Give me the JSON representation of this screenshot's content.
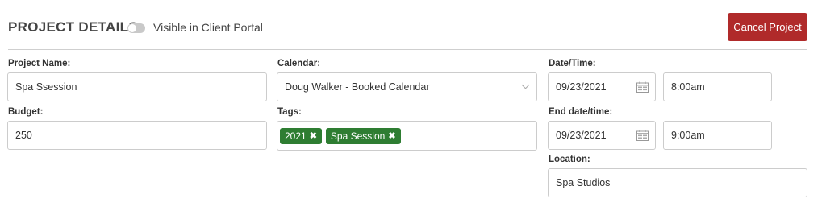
{
  "header": {
    "title": "PROJECT DETAILS:",
    "toggle_label": "Visible in Client Portal",
    "cancel_label": "Cancel Project"
  },
  "fields": {
    "project_name": {
      "label": "Project Name:",
      "value": "Spa Ssession"
    },
    "budget": {
      "label": "Budget:",
      "value": "250"
    },
    "calendar": {
      "label": "Calendar:",
      "value": "Doug Walker - Booked Calendar"
    },
    "tags": {
      "label": "Tags:",
      "items": [
        "2021",
        "Spa Session"
      ]
    },
    "start": {
      "label": "Date/Time:",
      "date": "09/23/2021",
      "time": "8:00am"
    },
    "end": {
      "label": "End date/time:",
      "date": "09/23/2021",
      "time": "9:00am"
    },
    "location": {
      "label": "Location:",
      "value": "Spa Studios"
    }
  },
  "colors": {
    "cancel_button": "#b02a2a",
    "tag_bg": "#2e7d32",
    "toggle_off": "#c9c9c9"
  },
  "icons": {
    "tag_remove": "x-icon",
    "date_picker": "calendar-icon",
    "select": "chevron-down-icon"
  }
}
